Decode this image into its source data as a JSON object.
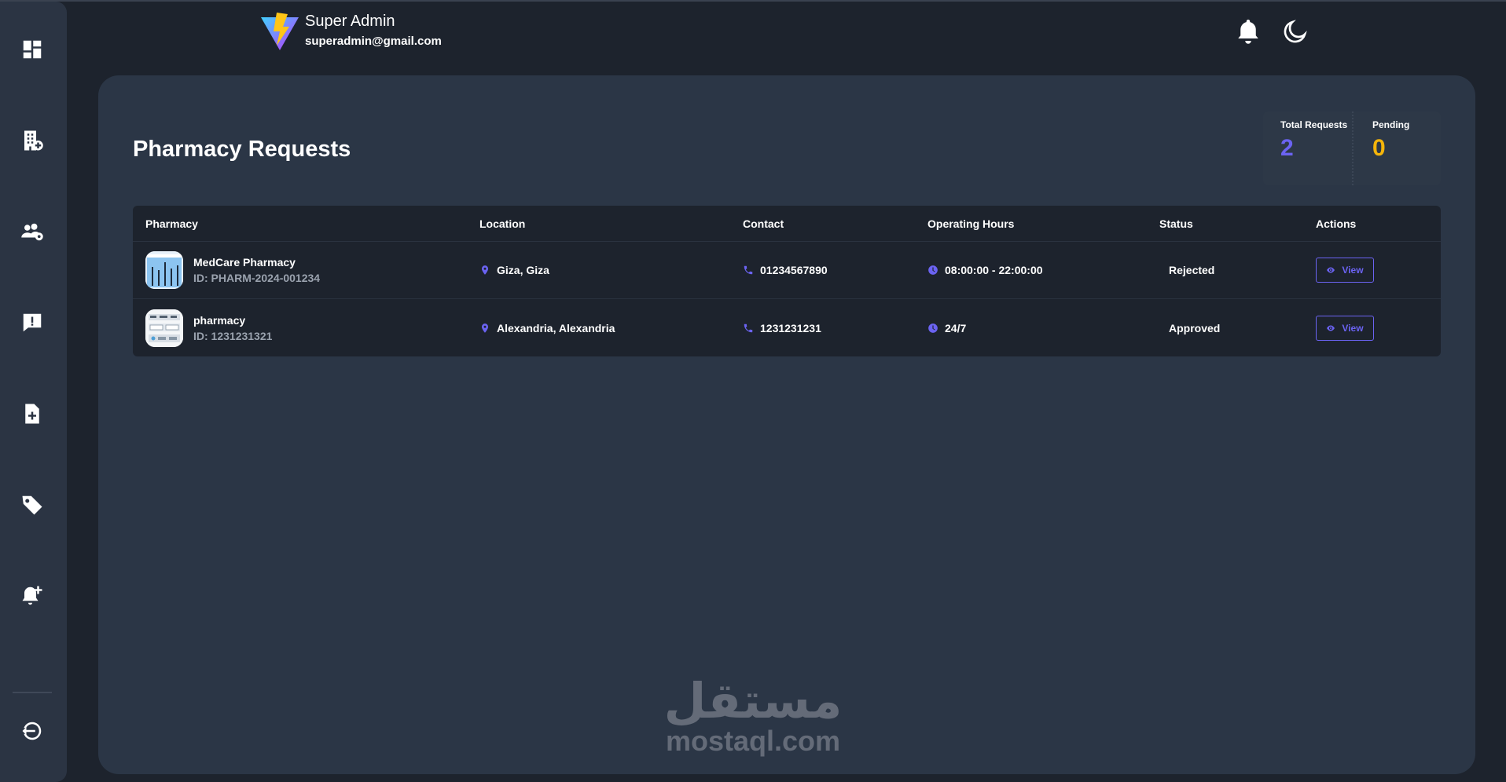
{
  "header": {
    "user_name": "Super Admin",
    "user_email": "superadmin@gmail.com",
    "icons": [
      "vite-logo-icon",
      "bell-icon",
      "moon-icon"
    ]
  },
  "sidebar": {
    "items": [
      {
        "icon": "dashboard-icon"
      },
      {
        "icon": "hospital-building-icon"
      },
      {
        "icon": "users-settings-icon"
      },
      {
        "icon": "message-alert-icon"
      },
      {
        "icon": "medical-file-icon"
      },
      {
        "icon": "tag-icon"
      },
      {
        "icon": "bell-plus-icon"
      },
      {
        "icon": "logout-icon"
      }
    ]
  },
  "page": {
    "title": "Pharmacy Requests"
  },
  "stats": {
    "total_label": "Total Requests",
    "total_value": "2",
    "pending_label": "Pending",
    "pending_value": "0",
    "total_color": "#6b63f2",
    "pending_color": "#f5b50a"
  },
  "table": {
    "headers": {
      "pharmacy": "Pharmacy",
      "location": "Location",
      "contact": "Contact",
      "hours": "Operating Hours",
      "status": "Status",
      "actions": "Actions"
    },
    "rows": [
      {
        "name": "MedCare Pharmacy",
        "id": "ID: PHARM-2024-001234",
        "location": "Giza, Giza",
        "contact": "01234567890",
        "hours": "08:00:00 - 22:00:00",
        "status": "Rejected",
        "action": "View"
      },
      {
        "name": "pharmacy",
        "id": "ID: 1231231321",
        "location": "Alexandria, Alexandria",
        "contact": "1231231231",
        "hours": "24/7",
        "status": "Approved",
        "action": "View"
      }
    ]
  },
  "watermark": {
    "arabic": "مستقل",
    "latin": "mostaql.com"
  },
  "colors": {
    "accent": "#6b63f2",
    "pending": "#f5b50a",
    "panel": "#2b3646",
    "background": "#1d232d"
  }
}
